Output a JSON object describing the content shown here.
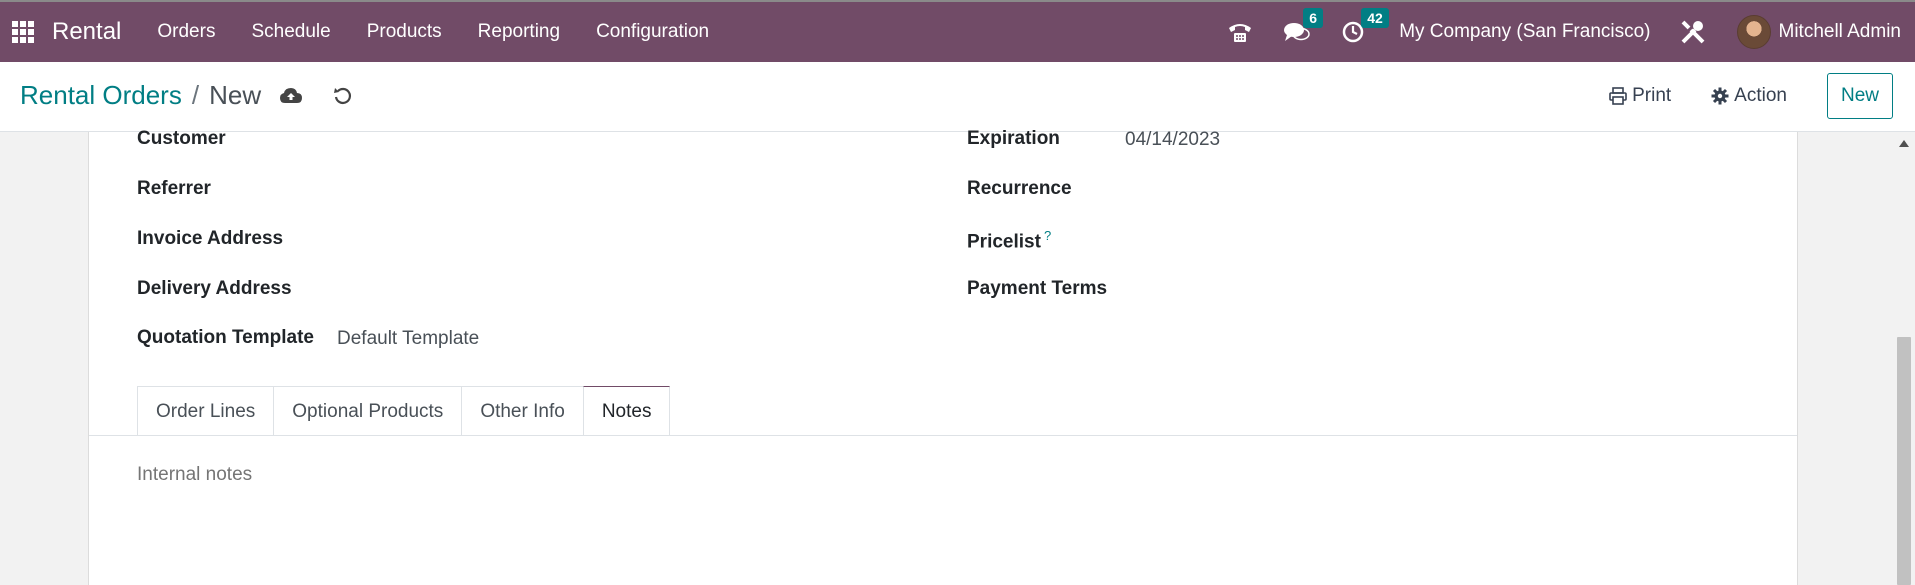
{
  "navbar": {
    "brand": "Rental",
    "menu": [
      "Orders",
      "Schedule",
      "Products",
      "Reporting",
      "Configuration"
    ],
    "messages_count": "6",
    "activities_count": "42",
    "company": "My Company (San Francisco)",
    "user": "Mitchell Admin",
    "icons": [
      "apps-grid-icon",
      "phone-icon",
      "chat-icon",
      "clock-icon",
      "tools-icon"
    ]
  },
  "control": {
    "breadcrumb_parent": "Rental Orders",
    "breadcrumb_sep": "/",
    "breadcrumb_current": "New",
    "print_label": "Print",
    "action_label": "Action",
    "new_label": "New"
  },
  "form": {
    "left": [
      {
        "label": "Customer",
        "value": ""
      },
      {
        "label": "Referrer",
        "value": ""
      },
      {
        "label": "Invoice Address",
        "value": ""
      },
      {
        "label": "Delivery Address",
        "value": ""
      },
      {
        "label": "Quotation Template",
        "value": "Default Template"
      }
    ],
    "right": [
      {
        "label": "Expiration",
        "value": "04/14/2023"
      },
      {
        "label": "Recurrence",
        "value": ""
      },
      {
        "label": "Pricelist",
        "value": "",
        "help": "?"
      },
      {
        "label": "Payment Terms",
        "value": ""
      }
    ]
  },
  "tabs": [
    "Order Lines",
    "Optional Products",
    "Other Info",
    "Notes"
  ],
  "active_tab": "Notes",
  "notes": {
    "placeholder": "Internal notes",
    "value": ""
  },
  "colors": {
    "navbar": "#714b67",
    "accent": "#017e84"
  }
}
